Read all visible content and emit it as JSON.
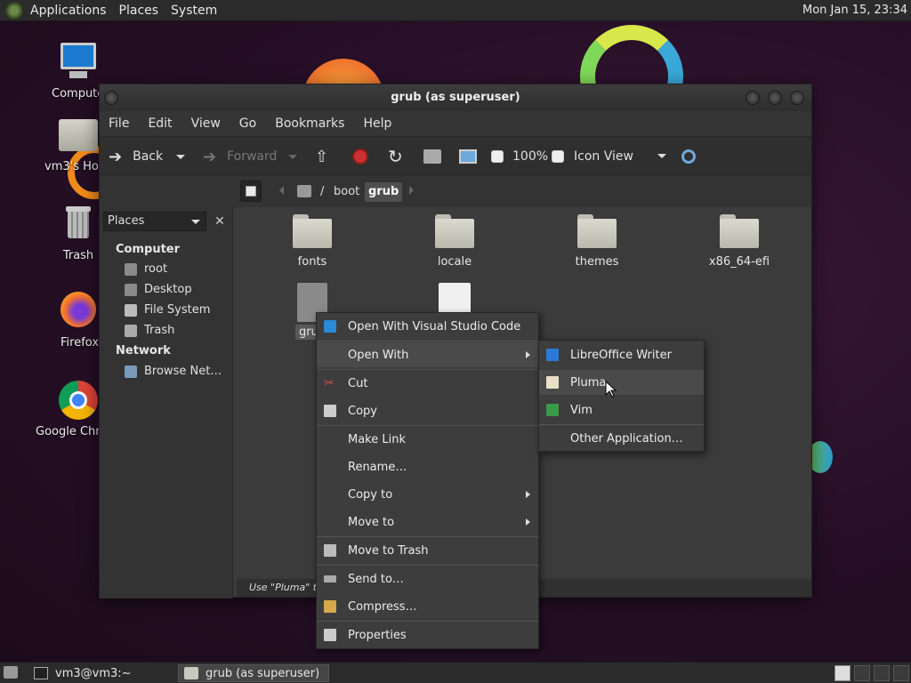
{
  "top_panel": {
    "menus": [
      "Applications",
      "Places",
      "System"
    ],
    "clock": "Mon Jan 15, 23:34"
  },
  "desktop_icons": [
    {
      "label": "Computer",
      "icon": "computer-icon"
    },
    {
      "label": "vm3's Home",
      "icon": "home-folder-icon"
    },
    {
      "label": "Trash",
      "icon": "trash-icon"
    },
    {
      "label": "Firefox",
      "icon": "firefox-icon"
    },
    {
      "label": "Google Chrome",
      "icon": "chrome-icon"
    }
  ],
  "window": {
    "title": "grub (as superuser)",
    "menubar": [
      "File",
      "Edit",
      "View",
      "Go",
      "Bookmarks",
      "Help"
    ],
    "toolbar": {
      "back": "Back",
      "forward": "Forward",
      "zoom": "100%",
      "view_mode": "Icon View"
    },
    "path": {
      "root": "/",
      "segments": [
        "boot",
        "grub"
      ]
    },
    "sidebar": {
      "selector": "Places",
      "computer_header": "Computer",
      "computer_items": [
        "root",
        "Desktop",
        "File System",
        "Trash"
      ],
      "network_header": "Network",
      "network_items": [
        "Browse Net…"
      ]
    },
    "files": [
      {
        "name": "fonts",
        "type": "folder"
      },
      {
        "name": "locale",
        "type": "folder"
      },
      {
        "name": "themes",
        "type": "folder"
      },
      {
        "name": "x86_64-efi",
        "type": "folder"
      },
      {
        "name": "grub",
        "type": "file",
        "selected": true
      },
      {
        "name": "",
        "type": "file"
      }
    ],
    "status": "Use \"Pluma\" to"
  },
  "context_menu": {
    "items": [
      "Open With Visual Studio Code",
      "Open With",
      "Cut",
      "Copy",
      "Make Link",
      "Rename…",
      "Copy to",
      "Move to",
      "Move to Trash",
      "Send to…",
      "Compress…",
      "Properties"
    ]
  },
  "open_with_submenu": {
    "items": [
      "LibreOffice Writer",
      "Pluma",
      "Vim",
      "Other Application…"
    ],
    "hovered": "Pluma"
  },
  "taskbar": {
    "tasks": [
      "vm3@vm3:~",
      "grub (as superuser)"
    ]
  },
  "colors": {
    "accent": "#3a9ad9",
    "panel": "#2b2b2b",
    "menu_bg": "#3d3d3d"
  }
}
